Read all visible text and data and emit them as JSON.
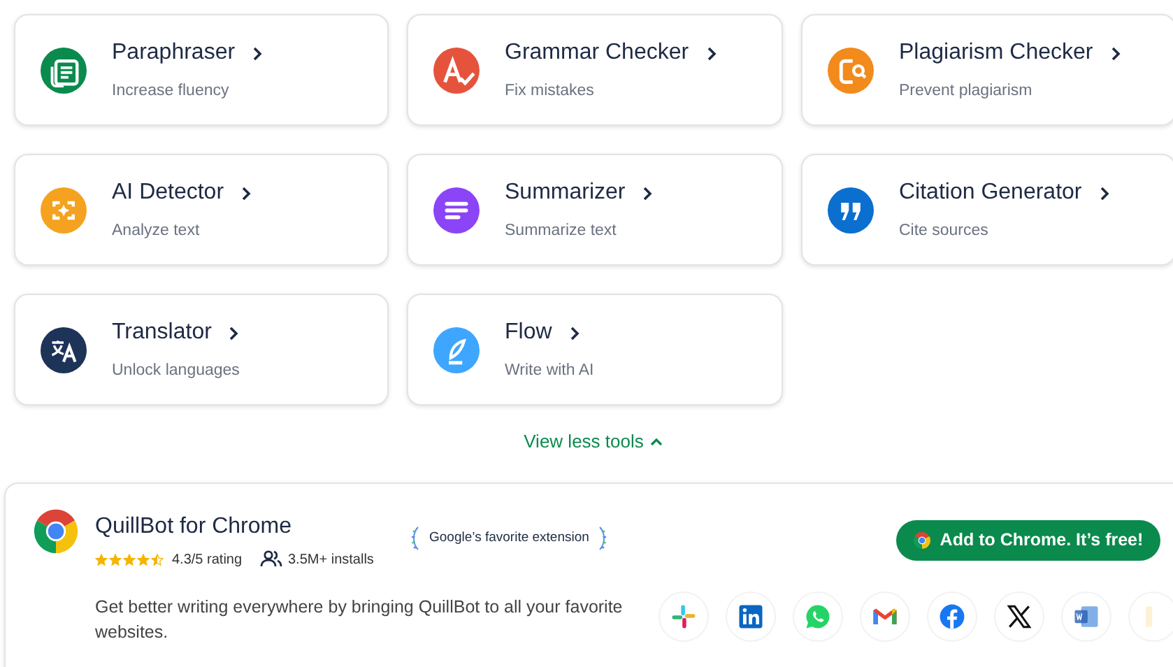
{
  "tools": [
    {
      "title": "Paraphraser",
      "subtitle": "Increase fluency",
      "color": "#0b8a4e"
    },
    {
      "title": "Grammar Checker",
      "subtitle": "Fix mistakes",
      "color": "#e5533d"
    },
    {
      "title": "Plagiarism Checker",
      "subtitle": "Prevent plagiarism",
      "color": "#f28a1c"
    },
    {
      "title": "AI Detector",
      "subtitle": "Analyze text",
      "color": "#f4a21f"
    },
    {
      "title": "Summarizer",
      "subtitle": "Summarize text",
      "color": "#8c44f7"
    },
    {
      "title": "Citation Generator",
      "subtitle": "Cite sources",
      "color": "#0a6fcf"
    },
    {
      "title": "Translator",
      "subtitle": "Unlock languages",
      "color": "#1e3358"
    },
    {
      "title": "Flow",
      "subtitle": "Write with AI",
      "color": "#3ea6ff"
    }
  ],
  "toggle": {
    "label": "View less tools",
    "expanded": true
  },
  "extension": {
    "title": "QuillBot for Chrome",
    "stars": 4.5,
    "rating": "4.3/5 rating",
    "installs": "3.5M+ installs",
    "badge": "Google’s favorite extension",
    "button": "Add to Chrome. It’s free!",
    "description": "Get better writing everywhere by bringing QuillBot to all your favorite websites."
  }
}
